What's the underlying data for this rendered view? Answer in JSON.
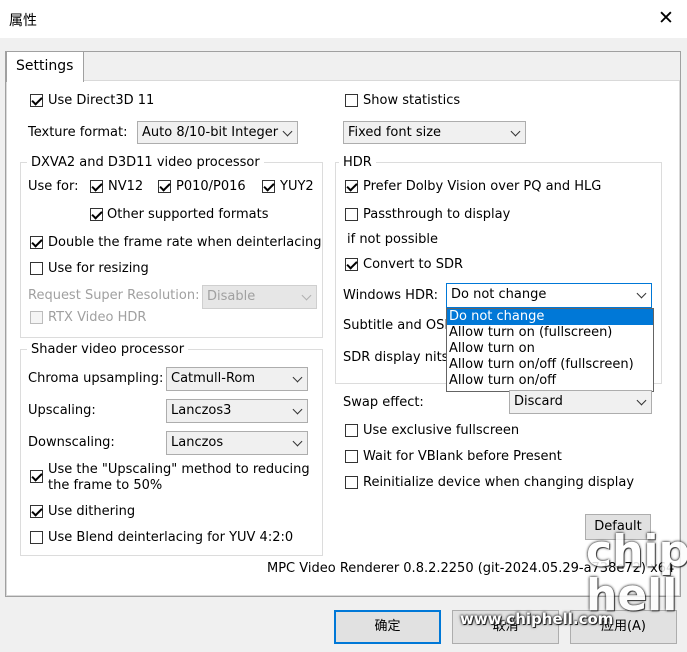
{
  "window": {
    "title": "属性",
    "close_glyph": "✕"
  },
  "tabs": [
    {
      "label": "Settings"
    }
  ],
  "left": {
    "use_d3d11": {
      "label": "Use Direct3D 11",
      "checked": true
    },
    "texture_format": {
      "label": "Texture format:",
      "value": "Auto 8/10-bit Integer"
    },
    "dxva_group": {
      "title": "DXVA2 and D3D11 video processor",
      "use_for_label": "Use for:",
      "nv12": {
        "label": "NV12",
        "checked": true
      },
      "p010": {
        "label": "P010/P016",
        "checked": true
      },
      "yuy2": {
        "label": "YUY2",
        "checked": true
      },
      "other_formats": {
        "label": "Other supported formats",
        "checked": true
      },
      "double_frame_rate": {
        "label": "Double the frame rate when deinterlacing",
        "checked": true
      },
      "use_for_resizing": {
        "label": "Use for resizing",
        "checked": false
      },
      "request_super_res": {
        "label": "Request Super Resolution:",
        "value": "Disable"
      },
      "rtx_hdr": {
        "label": "RTX Video HDR",
        "checked": false
      }
    },
    "shader_group": {
      "title": "Shader video processor",
      "chroma": {
        "label": "Chroma upsampling:",
        "value": "Catmull-Rom"
      },
      "upscaling": {
        "label": "Upscaling:",
        "value": "Lanczos3"
      },
      "downscaling": {
        "label": "Downscaling:",
        "value": "Lanczos"
      },
      "upscaling_method": {
        "label_line1": "Use the \"Upscaling\" method to reducing",
        "label_line2": "the frame to 50%",
        "checked": true
      },
      "dithering": {
        "label": "Use dithering",
        "checked": true
      },
      "blend_deint": {
        "label": "Use Blend deinterlacing for YUV 4:2:0",
        "checked": false
      }
    }
  },
  "right": {
    "show_stats": {
      "label": "Show statistics",
      "checked": false
    },
    "font_size": {
      "value": "Fixed font size"
    },
    "hdr_group": {
      "title": "HDR",
      "dolby_vision": {
        "label": "Prefer Dolby Vision over PQ and HLG",
        "checked": true
      },
      "passthrough": {
        "label": "Passthrough to display",
        "checked": false
      },
      "if_not_possible": "if not possible",
      "convert_sdr": {
        "label": "Convert to SDR",
        "checked": true
      },
      "windows_hdr": {
        "label": "Windows HDR:",
        "value": "Do not change",
        "options": [
          "Do not change",
          "Allow turn on (fullscreen)",
          "Allow turn on",
          "Allow turn on/off (fullscreen)",
          "Allow turn on/off"
        ]
      },
      "subtitle_osd_label": "Subtitle and OSD",
      "sdr_nits_label": "SDR display nits:"
    },
    "swap_effect": {
      "label": "Swap effect:",
      "value": "Discard"
    },
    "exclusive_fullscreen": {
      "label": "Use exclusive fullscreen",
      "checked": false
    },
    "wait_vblank": {
      "label": "Wait for VBlank before Present",
      "checked": false
    },
    "reinit_device": {
      "label": "Reinitialize device when changing display",
      "checked": false
    },
    "default_button": "Default"
  },
  "version": "MPC Video Renderer 0.8.2.2250 (git-2024.05.29-a738e72) x64",
  "buttons": {
    "ok": "确定",
    "cancel": "取消",
    "apply": "应用(A)"
  },
  "watermark": {
    "site": "www.chiphell.com",
    "logo": "chip hell"
  }
}
